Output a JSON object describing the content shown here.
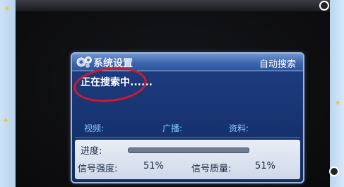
{
  "window": {
    "title": "系统设置",
    "mode": "自动搜索"
  },
  "status": {
    "searching_text": "正在搜索中......"
  },
  "info": {
    "video_label": "视频:",
    "broadcast_label": "广播:",
    "data_label": "资料:"
  },
  "progress": {
    "label": "进度:",
    "value": 0
  },
  "signal": {
    "strength_label": "信号强度:",
    "strength_value": "51%",
    "quality_label": "信号质量:",
    "quality_value": "51%"
  },
  "colors": {
    "panel_bg": "#1f3d83",
    "title_bar": "#3e66ad",
    "info_label": "#8ec6ff",
    "annotation_circle": "#d2192a"
  },
  "icons": {
    "title_logo": "satellite-gear-icon"
  }
}
